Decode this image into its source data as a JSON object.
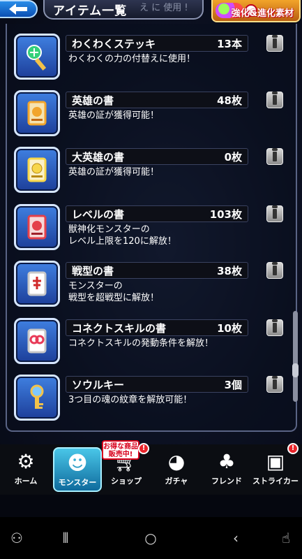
{
  "header": {
    "title": "アイテム一覧",
    "subtitle_fragment": "え に 使用 !",
    "corner_badge_label": "強化&進化素材"
  },
  "items": [
    {
      "name": "わくわくステッキ",
      "count": "13本",
      "description": "わくわくの力の付替えに使用！",
      "icon": "magic-wand-icon",
      "icon_color": "#34d07a"
    },
    {
      "name": "英雄の書",
      "count": "48枚",
      "description": "英雄の証が獲得可能！",
      "icon": "hero-scroll-icon",
      "icon_color": "#f2a52c"
    },
    {
      "name": "大英雄の書",
      "count": "0枚",
      "description": "英雄の証が獲得可能！",
      "icon": "great-hero-scroll-icon",
      "icon_color": "#f7d64a"
    },
    {
      "name": "レベルの書",
      "count": "103枚",
      "description": "獣神化モンスターの\nレベル上限を120に解放！",
      "icon": "level-scroll-icon",
      "icon_color": "#e4404a"
    },
    {
      "name": "戦型の書",
      "count": "38枚",
      "description": "モンスターの\n戦型を超戦型に解放！",
      "icon": "battle-type-scroll-icon",
      "icon_color": "#e8e8e8"
    },
    {
      "name": "コネクトスキルの書",
      "count": "10枚",
      "description": "コネクトスキルの発動条件を解放！",
      "icon": "connect-skill-scroll-icon",
      "icon_color": "#e83a58"
    },
    {
      "name": "ソウルキー",
      "count": "3個",
      "description": "3つ目の魂の紋章を解放可能！",
      "icon": "soul-key-icon",
      "icon_color": "#7ec8ff"
    }
  ],
  "tabs": [
    {
      "label": "ホーム",
      "icon": "home-gear-icon",
      "active": false
    },
    {
      "label": "モンスター",
      "icon": "monster-icon",
      "active": true
    },
    {
      "label": "ショップ",
      "icon": "shop-cart-icon",
      "active": false
    },
    {
      "label": "ガチャ",
      "icon": "gacha-icon",
      "active": false
    },
    {
      "label": "フレンド",
      "icon": "friend-icon",
      "active": false
    },
    {
      "label": "ストライカー",
      "icon": "striker-card-icon",
      "active": false
    }
  ],
  "shop_deal_badge": "お得な商品\n販売中!",
  "notification_mark": "!",
  "colors": {
    "active_tab": "#2aa7d6",
    "notification": "#e8242a",
    "back_button": "#1f6fd0"
  }
}
